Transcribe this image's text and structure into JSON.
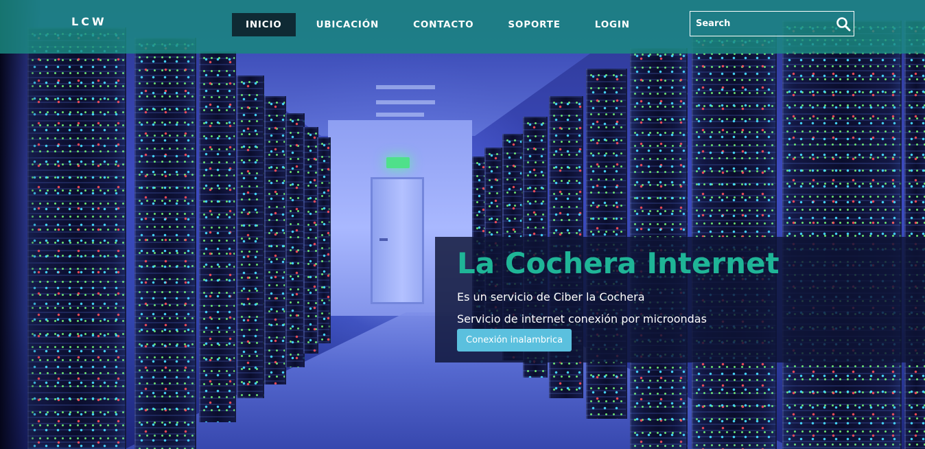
{
  "navbar": {
    "brand": "LCW",
    "items": [
      {
        "label": "INICIO",
        "active": true
      },
      {
        "label": "UBICACIÓN",
        "active": false
      },
      {
        "label": "CONTACTO",
        "active": false
      },
      {
        "label": "SOPORTE",
        "active": false
      },
      {
        "label": "LOGIN",
        "active": false
      }
    ],
    "search": {
      "placeholder": "Search",
      "icon": "search-icon"
    }
  },
  "hero": {
    "title": "La Cochera Internet",
    "line1": "Es un servicio de Ciber la Cochera",
    "line2": "Servicio de internet conexión por microondas",
    "button_label": "Conexión inalambrica"
  },
  "colors": {
    "navbar_bg": "#1b8c82",
    "active_item_bg": "#0f2a34",
    "title_accent": "#1fb597",
    "button_bg": "#5bc0de",
    "caption_panel_bg": "#0e1434"
  }
}
